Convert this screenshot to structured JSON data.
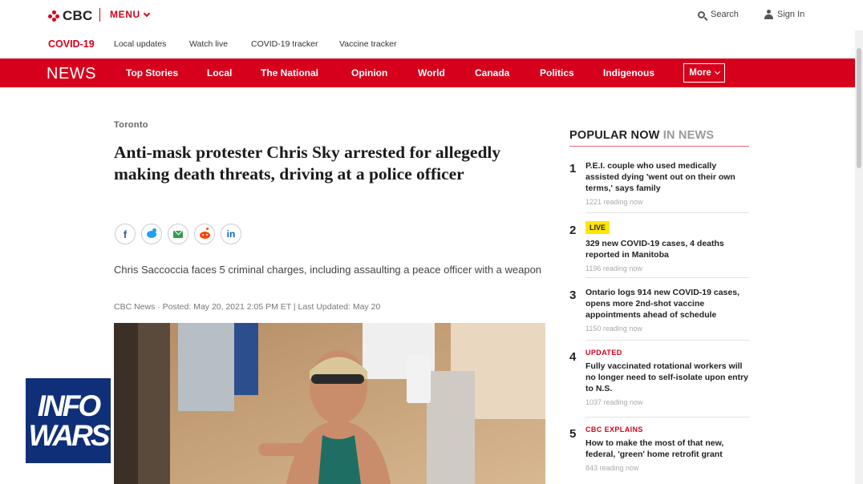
{
  "header": {
    "logo_text": "CBC",
    "menu_label": "MENU",
    "search_label": "Search",
    "signin_label": "Sign In"
  },
  "covid_bar": {
    "label": "COVID-19",
    "links": [
      "Local updates",
      "Watch live",
      "COVID-19 tracker",
      "Vaccine tracker"
    ]
  },
  "news_nav": {
    "section": "NEWS",
    "items": [
      "Top Stories",
      "Local",
      "The National",
      "Opinion",
      "World",
      "Canada",
      "Politics",
      "Indigenous"
    ],
    "more_label": "More"
  },
  "article": {
    "section": "Toronto",
    "headline": "Anti-mask protester Chris Sky arrested for allegedly making death threats, driving at a police officer",
    "deck": "Chris Saccoccia faces 5 criminal charges, including assaulting a peace officer with a weapon",
    "byline": "CBC News · Posted: May 20, 2021 2:05 PM ET | Last Updated: May 20",
    "share_icons": [
      "facebook-icon",
      "twitter-icon",
      "email-icon",
      "reddit-icon",
      "linkedin-icon"
    ]
  },
  "popular": {
    "heading": "POPULAR NOW",
    "heading_sub": "IN NEWS",
    "items": [
      {
        "rank": "1",
        "tag": "",
        "title": "P.E.I. couple who used medically assisted dying 'went out on their own terms,' says family",
        "meta": "1221 reading now"
      },
      {
        "rank": "2",
        "tag": "LIVE",
        "title": "329 new COVID-19 cases, 4 deaths reported in Manitoba",
        "meta": "1196 reading now"
      },
      {
        "rank": "3",
        "tag": "",
        "title": "Ontario logs 914 new COVID-19 cases, opens more 2nd-shot vaccine appointments ahead of schedule",
        "meta": "1150 reading now"
      },
      {
        "rank": "4",
        "tag": "UPDATED",
        "title": "Fully vaccinated rotational workers will no longer need to self-isolate upon entry to N.S.",
        "meta": "1037 reading now"
      },
      {
        "rank": "5",
        "tag": "CBC EXPLAINS",
        "title": "How to make the most of that new, federal, 'green' home retrofit grant",
        "meta": "843 reading now"
      }
    ]
  },
  "overlay": {
    "logo_line1": "INFO",
    "logo_line2": "WARS"
  },
  "colors": {
    "brand_red": "#d6001c",
    "live_yellow": "#ffe600",
    "overlay_blue": "#0f2f78"
  }
}
